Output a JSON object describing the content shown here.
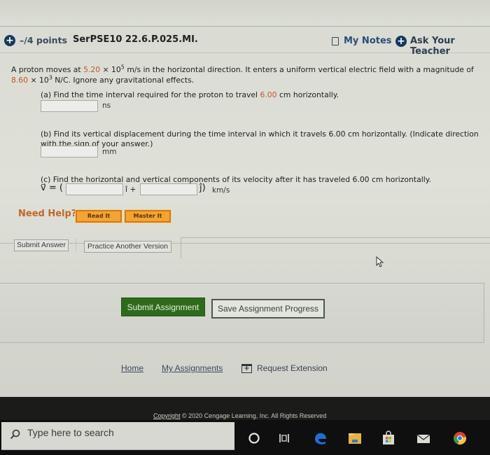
{
  "header": {
    "points": "–/4 points",
    "question_id": "SerPSE10 22.6.P.025.MI.",
    "my_notes": "My Notes",
    "ask_teacher": "Ask Your Teacher"
  },
  "problem": {
    "intro_1": "A proton moves at ",
    "speed_mantissa": "5.20",
    "times": " × 10",
    "speed_exp": "5",
    "intro_2": " m/s in the horizontal direction. It enters a uniform vertical electric field with a magnitude of",
    "field_mantissa": "8.60",
    "field_times": " × 10",
    "field_exp": "3",
    "intro_3": " N/C. Ignore any gravitational effects."
  },
  "parts": {
    "a": {
      "text_1": "(a) Find the time interval required for the proton to travel ",
      "distance": "6.00",
      "text_2": " cm horizontally.",
      "answer_value": "",
      "unit": "ns"
    },
    "b": {
      "text_line1": "(b) Find its vertical displacement during the time interval in which it travels 6.00 cm horizontally. (Indicate direction",
      "text_line2": "with the sign of your answer.)",
      "answer_value": "",
      "unit": "mm"
    },
    "c": {
      "text": "(c) Find the horizontal and vertical components of its velocity after it has traveled 6.00 cm horizontally.",
      "vector_label": "v⃗ = (",
      "i_hat": "î +",
      "j_hat": "ĵ)",
      "answer_i": "",
      "answer_j": "",
      "unit": "km/s"
    }
  },
  "help": {
    "label": "Need Help?",
    "read_it": "Read It",
    "master_it": "Master It"
  },
  "actions": {
    "submit_answer": "Submit Answer",
    "practice_another": "Practice Another Version"
  },
  "assignment": {
    "submit": "Submit Assignment",
    "save_progress": "Save Assignment Progress"
  },
  "footer": {
    "home": "Home",
    "my_assignments": "My Assignments",
    "request_extension": "Request Extension",
    "copyright_link": "Copyright",
    "copyright_text": " © 2020 Cengage Learning, Inc. All Rights Reserved"
  },
  "taskbar": {
    "search_placeholder": "Type here to search",
    "apps": [
      "cortana",
      "task-view",
      "edge",
      "file-explorer",
      "store",
      "mail",
      "chrome"
    ]
  },
  "colors": {
    "accent_orange": "#c0562a",
    "submit_green": "#2e6a1b",
    "help_orange": "#f3a431",
    "link_blue": "#2b4d78"
  }
}
